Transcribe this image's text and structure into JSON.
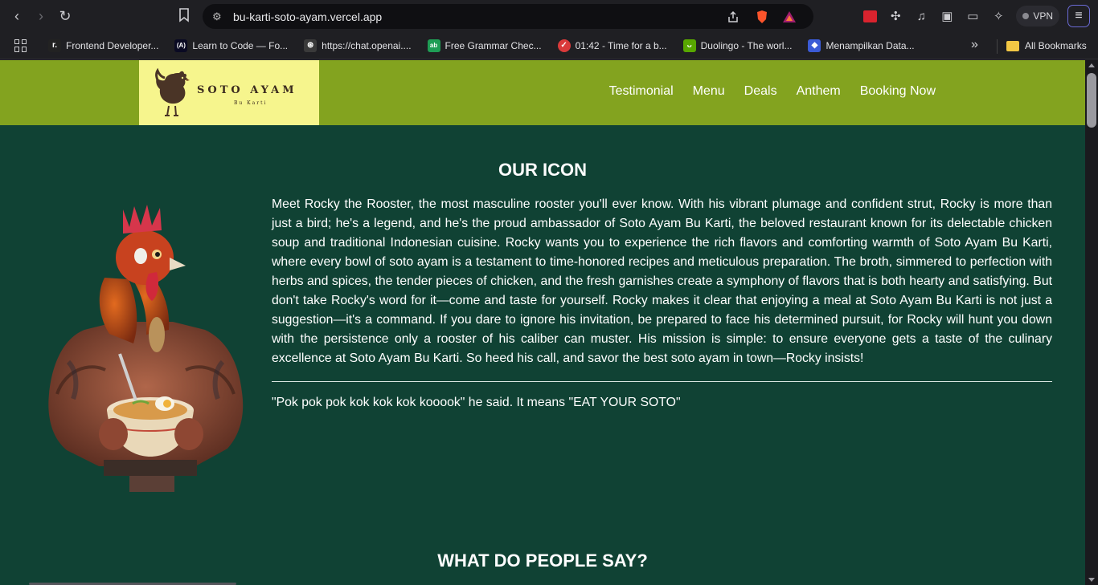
{
  "browser": {
    "url": "bu-karti-soto-ayam.vercel.app",
    "vpn_label": "VPN",
    "bookmarks": [
      {
        "label": "Frontend Developer...",
        "icon": "roadmap-icon",
        "color": "#222222",
        "glyph": "r."
      },
      {
        "label": "Learn to Code — Fo...",
        "icon": "freecodecamp-icon",
        "color": "#0a0a23",
        "glyph": "(A)"
      },
      {
        "label": "https://chat.openai....",
        "icon": "openai-icon",
        "color": "#3a3a3a",
        "glyph": "⊛"
      },
      {
        "label": "Free Grammar Chec...",
        "icon": "grammar-icon",
        "color": "#1f9d55",
        "glyph": "ab"
      },
      {
        "label": "01:42 - Time for a b...",
        "icon": "pomodoro-icon",
        "color": "#d93a3a",
        "glyph": "✓"
      },
      {
        "label": "Duolingo - The worl...",
        "icon": "duolingo-icon",
        "color": "#58a700",
        "glyph": "ᴗ"
      },
      {
        "label": "Menampilkan Data...",
        "icon": "data-icon",
        "color": "#3b5bd6",
        "glyph": "◆"
      }
    ],
    "all_bookmarks_label": "All Bookmarks"
  },
  "site": {
    "logo": {
      "title": "SOTO AYAM",
      "subtitle": "Bu Karti"
    },
    "nav": [
      {
        "label": "Testimonial"
      },
      {
        "label": "Menu"
      },
      {
        "label": "Deals"
      },
      {
        "label": "Anthem"
      },
      {
        "label": "Booking Now"
      }
    ],
    "icon_section": {
      "heading": "OUR ICON",
      "body": "Meet Rocky the Rooster, the most masculine rooster you'll ever know. With his vibrant plumage and confident strut, Rocky is more than just a bird; he's a legend, and he's the proud ambassador of Soto Ayam Bu Karti, the beloved restaurant known for its delectable chicken soup and traditional Indonesian cuisine. Rocky wants you to experience the rich flavors and comforting warmth of Soto Ayam Bu Karti, where every bowl of soto ayam is a testament to time-honored recipes and meticulous preparation. The broth, simmered to perfection with herbs and spices, the tender pieces of chicken, and the fresh garnishes create a symphony of flavors that is both hearty and satisfying. But don't take Rocky's word for it—come and taste for yourself. Rocky makes it clear that enjoying a meal at Soto Ayam Bu Karti is not just a suggestion—it's a command. If you dare to ignore his invitation, be prepared to face his determined pursuit, for Rocky will hunt you down with the persistence only a rooster of his caliber can muster. His mission is simple: to ensure everyone gets a taste of the culinary excellence at Soto Ayam Bu Karti. So heed his call, and savor the best soto ayam in town—Rocky insists!",
      "quote": "\"Pok pok pok kok kok kok kooook\" he said. It means \"EAT YOUR SOTO\""
    },
    "testimonial_heading": "WHAT DO PEOPLE SAY?",
    "colors": {
      "header": "#83a31f",
      "page_bg": "#104234",
      "logo_bg": "#f6f58d"
    }
  }
}
